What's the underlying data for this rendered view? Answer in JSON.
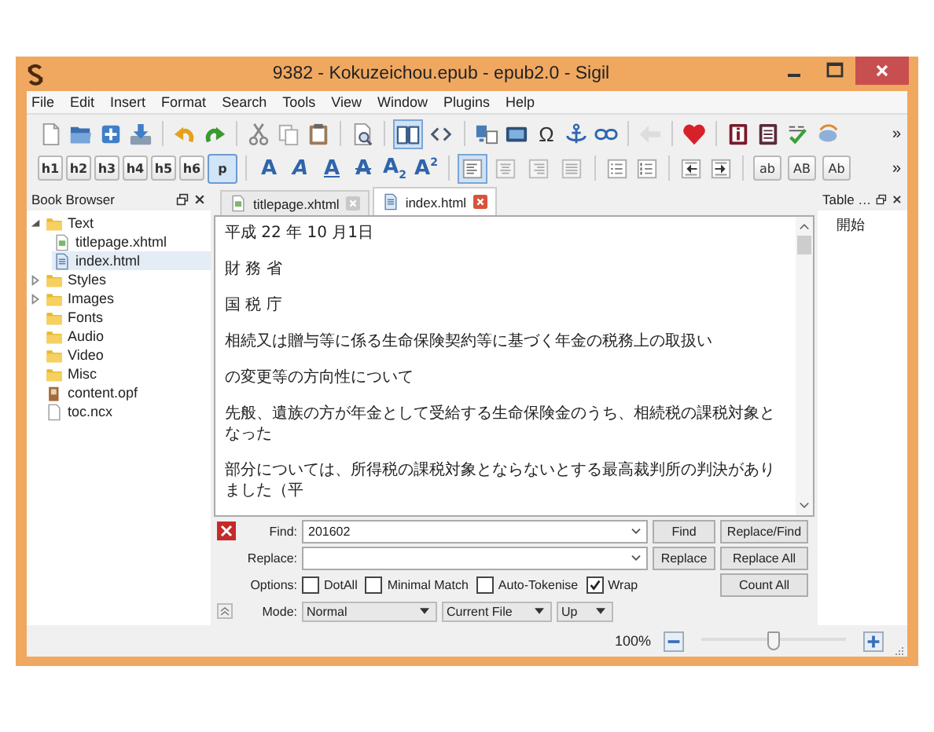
{
  "window": {
    "title": "9382 - Kokuzeichou.epub - epub2.0 - Sigil"
  },
  "menu": [
    "File",
    "Edit",
    "Insert",
    "Format",
    "Search",
    "Tools",
    "View",
    "Window",
    "Plugins",
    "Help"
  ],
  "toolbar1": {
    "view_modes": [
      {
        "selected": true
      },
      {
        "selected": false
      }
    ],
    "symbol": "Ω",
    "overflow": "»"
  },
  "toolbar2": {
    "headings": [
      {
        "label": "h1",
        "selected": false
      },
      {
        "label": "h2",
        "selected": false
      },
      {
        "label": "h3",
        "selected": false
      },
      {
        "label": "h4",
        "selected": false
      },
      {
        "label": "h5",
        "selected": false
      },
      {
        "label": "h6",
        "selected": false
      },
      {
        "label": "p",
        "selected": true
      }
    ],
    "formats": [
      {
        "kind": "bold",
        "label": "A"
      },
      {
        "kind": "italic",
        "label": "A"
      },
      {
        "kind": "underline",
        "label": "A"
      },
      {
        "kind": "strike",
        "label": "A"
      },
      {
        "kind": "subscript",
        "label": "A$_{2}$"
      },
      {
        "kind": "superscript",
        "label": "A$^{2}$"
      }
    ],
    "alignments": [
      {
        "selected": true
      },
      {
        "selected": false
      },
      {
        "selected": false
      },
      {
        "selected": false
      }
    ],
    "case_buttons": [
      "ab",
      "AB",
      "Ab"
    ],
    "overflow": "»"
  },
  "book_browser": {
    "title": "Book Browser",
    "items": [
      {
        "label": "Text",
        "kind": "folder",
        "expanded": true,
        "selected": false,
        "children": [
          {
            "label": "titlepage.xhtml",
            "kind": "page",
            "selected": false
          },
          {
            "label": "index.html",
            "kind": "html",
            "selected": true
          }
        ]
      },
      {
        "label": "Styles",
        "kind": "folder",
        "expanded": false,
        "selected": false
      },
      {
        "label": "Images",
        "kind": "folder",
        "expanded": false,
        "selected": false
      },
      {
        "label": "Fonts",
        "kind": "empty-folder",
        "selected": false
      },
      {
        "label": "Audio",
        "kind": "empty-folder",
        "selected": false
      },
      {
        "label": "Video",
        "kind": "empty-folder",
        "selected": false
      },
      {
        "label": "Misc",
        "kind": "empty-folder",
        "selected": false
      },
      {
        "label": "content.opf",
        "kind": "opf",
        "selected": false
      },
      {
        "label": "toc.ncx",
        "kind": "ncx",
        "selected": false
      }
    ]
  },
  "tabs": [
    {
      "label": "titlepage.xhtml",
      "selected": false
    },
    {
      "label": "index.html",
      "selected": true
    }
  ],
  "editor": {
    "paragraphs": [
      "平成 22 年 10 月1日",
      "財 務 省",
      "国 税 庁",
      "相続又は贈与等に係る生命保険契約等に基づく年金の税務上の取扱い",
      "の変更等の方向性について",
      "先般、遺族の方が年金として受給する生命保険金のうち、相続税の課税対象となった",
      "部分については、所得税の課税対象とならないとする最高裁判所の判決がありました（平"
    ]
  },
  "toc": {
    "title": "Table …",
    "items": [
      "開始"
    ]
  },
  "find_bar": {
    "find_label": "Find:",
    "find_value": "201602",
    "replace_label": "Replace:",
    "buttons": [
      "Find",
      "Replace/Find",
      "Replace",
      "Replace All",
      "Count All"
    ],
    "options_label": "Options:",
    "options": [
      {
        "label": "DotAll",
        "checked": false
      },
      {
        "label": "Minimal Match",
        "checked": false
      },
      {
        "label": "Auto-Tokenise",
        "checked": false
      },
      {
        "label": "Wrap",
        "checked": true
      }
    ],
    "mode_label": "Mode:",
    "mode": "Normal",
    "scope": "Current File",
    "direction": "Up"
  },
  "status_bar": {
    "zoom": "100%",
    "level": 0.5
  }
}
